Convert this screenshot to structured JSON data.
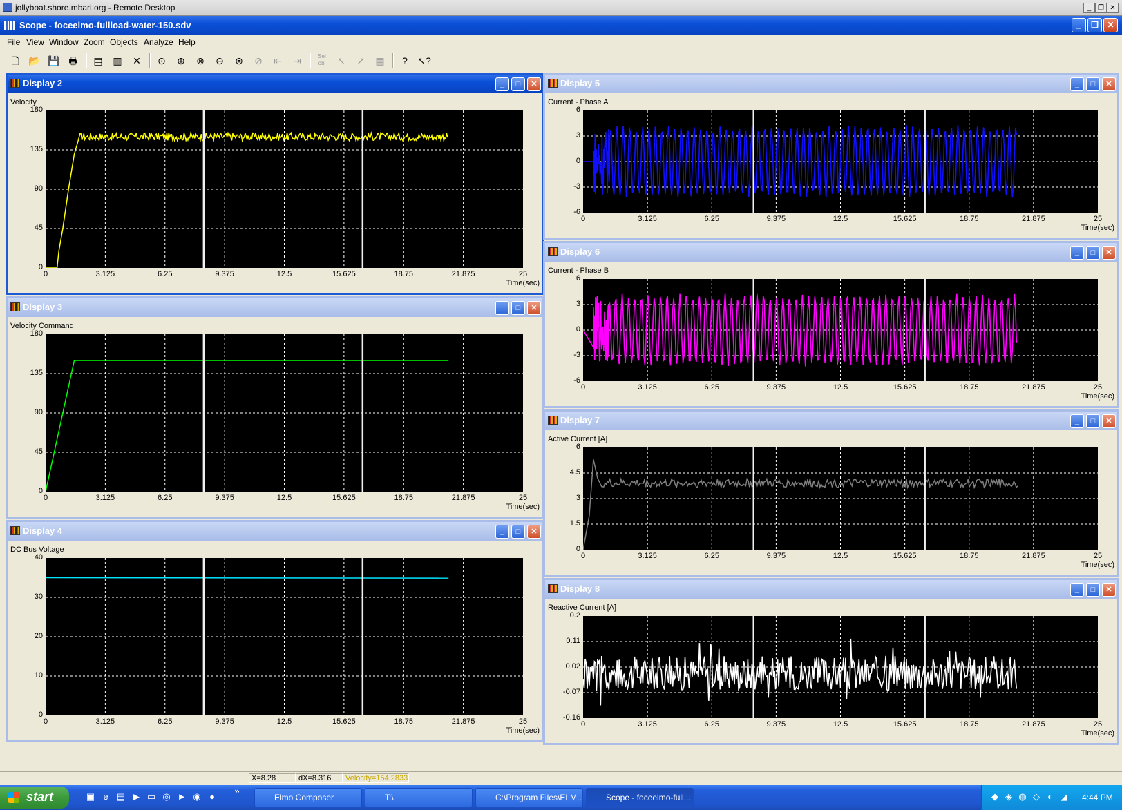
{
  "rdp": {
    "title": "jollyboat.shore.mbari.org - Remote Desktop"
  },
  "app": {
    "title": "Scope - foceelmo-fullload-water-150.sdv"
  },
  "menu": [
    "File",
    "View",
    "Window",
    "Zoom",
    "Objects",
    "Analyze",
    "Help"
  ],
  "toolbar": {
    "icons": [
      "new-file-icon",
      "open-folder-icon",
      "save-icon",
      "print-icon",
      "properties-icon",
      "chart-settings-icon",
      "delete-icon",
      "zoom-fit-icon",
      "zoom-in-icon",
      "zoom-x-icon",
      "zoom-out-icon",
      "zoom-reset-icon",
      "zoom-prev-icon",
      "scroll-left-icon",
      "scroll-right-icon",
      "select-object-icon",
      "cursor-tool-icon",
      "pointer-tool-icon",
      "export-icon",
      "help-icon",
      "context-help-icon"
    ],
    "sel_obj_label": "Sel obj"
  },
  "x_ticks": [
    "0",
    "3.125",
    "6.25",
    "9.375",
    "12.5",
    "15.625",
    "18.75",
    "21.875",
    "25"
  ],
  "x_unit": "Time(sec)",
  "colors": {
    "Display 2": "#ffff00",
    "Display 3": "#00ff00",
    "Display 4": "#00e5ff",
    "Display 5": "#1010ff",
    "Display 6": "#ff00ff",
    "Display 7": "#808080",
    "Display 8": "#ffffff"
  },
  "displays": [
    {
      "title": "Display 2",
      "label": "Velocity",
      "y_ticks": [
        "180",
        "135",
        "90",
        "45",
        "0"
      ]
    },
    {
      "title": "Display 3",
      "label": "Velocity Command",
      "y_ticks": [
        "180",
        "135",
        "90",
        "45",
        "0"
      ]
    },
    {
      "title": "Display 4",
      "label": "DC Bus Voltage",
      "y_ticks": [
        "40",
        "30",
        "20",
        "10",
        "0"
      ]
    },
    {
      "title": "Display 5",
      "label": "Current - Phase A",
      "y_ticks": [
        "6",
        "3",
        "0",
        "-3",
        "-6"
      ]
    },
    {
      "title": "Display 6",
      "label": "Current - Phase B",
      "y_ticks": [
        "6",
        "3",
        "0",
        "-3",
        "-6"
      ]
    },
    {
      "title": "Display 7",
      "label": "Active Current [A]",
      "y_ticks": [
        "6",
        "4.5",
        "3",
        "1.5",
        "0"
      ]
    },
    {
      "title": "Display 8",
      "label": "Reactive Current [A]",
      "y_ticks": [
        "0.2",
        "0.11",
        "0.02",
        "-0.07",
        "-0.16"
      ]
    }
  ],
  "chart_data": [
    {
      "type": "line",
      "title": "Display 2",
      "ylabel": "Velocity",
      "xlabel": "Time(sec)",
      "xlim": [
        0,
        25
      ],
      "ylim": [
        0,
        180
      ],
      "grid": true,
      "series": [
        {
          "values": [
            [
              0,
              0
            ],
            [
              0.6,
              0
            ],
            [
              0.9,
              45
            ],
            [
              1.2,
              90
            ],
            [
              1.6,
              135
            ],
            [
              1.9,
              148
            ],
            [
              3,
              150
            ],
            [
              6,
              149
            ],
            [
              9,
              150
            ],
            [
              12,
              148
            ],
            [
              15,
              150
            ],
            [
              18,
              149
            ],
            [
              21,
              150
            ],
            [
              21.1,
              148
            ]
          ]
        }
      ],
      "cursors": [
        8.28,
        16.6
      ]
    },
    {
      "type": "line",
      "title": "Display 3",
      "ylabel": "Velocity Command",
      "xlabel": "Time(sec)",
      "xlim": [
        0,
        25
      ],
      "ylim": [
        0,
        180
      ],
      "grid": true,
      "series": [
        {
          "values": [
            [
              0,
              0
            ],
            [
              0.5,
              30
            ],
            [
              1,
              80
            ],
            [
              1.5,
              150
            ],
            [
              21.1,
              150
            ]
          ]
        }
      ],
      "cursors": [
        8.28,
        16.6
      ]
    },
    {
      "type": "line",
      "title": "Display 4",
      "ylabel": "DC Bus Voltage",
      "xlabel": "Time(sec)",
      "xlim": [
        0,
        25
      ],
      "ylim": [
        0,
        40
      ],
      "grid": true,
      "series": [
        {
          "values": [
            [
              0,
              35
            ],
            [
              5,
              34.9
            ],
            [
              10,
              34.9
            ],
            [
              15,
              34.9
            ],
            [
              21.1,
              34.9
            ]
          ]
        }
      ],
      "cursors": [
        8.28,
        16.6
      ]
    },
    {
      "type": "line",
      "title": "Display 5",
      "ylabel": "Current - Phase A",
      "xlabel": "Time(sec)",
      "xlim": [
        0,
        25
      ],
      "ylim": [
        -6,
        6
      ],
      "grid": true,
      "series": [
        {
          "values": [
            [
              0,
              0
            ],
            [
              0.5,
              0
            ],
            [
              1,
              4
            ],
            [
              21,
              4
            ],
            [
              21,
              -4
            ]
          ]
        }
      ],
      "cursors": [
        8.28,
        16.6
      ]
    },
    {
      "type": "line",
      "title": "Display 6",
      "ylabel": "Current - Phase B",
      "xlabel": "Time(sec)",
      "xlim": [
        0,
        25
      ],
      "ylim": [
        -6,
        6
      ],
      "grid": true,
      "series": [
        {
          "values": [
            [
              0,
              -1
            ],
            [
              0.5,
              -3
            ],
            [
              1,
              4
            ],
            [
              21,
              4
            ],
            [
              21,
              -4
            ]
          ]
        }
      ],
      "cursors": [
        8.28,
        16.6
      ]
    },
    {
      "type": "line",
      "title": "Display 7",
      "ylabel": "Active Current [A]",
      "xlabel": "Time(sec)",
      "xlim": [
        0,
        25
      ],
      "ylim": [
        0,
        6
      ],
      "grid": true,
      "series": [
        {
          "values": [
            [
              0,
              0
            ],
            [
              0.3,
              2
            ],
            [
              0.5,
              5.3
            ],
            [
              0.8,
              3.8
            ],
            [
              3,
              3.9
            ],
            [
              10,
              3.7
            ],
            [
              15,
              4
            ],
            [
              21,
              4
            ]
          ]
        }
      ],
      "cursors": [
        8.28,
        16.6
      ]
    },
    {
      "type": "line",
      "title": "Display 8",
      "ylabel": "Reactive Current [A]",
      "xlabel": "Time(sec)",
      "xlim": [
        0,
        25
      ],
      "ylim": [
        -0.16,
        0.2
      ],
      "grid": true,
      "series": [
        {
          "values": [
            [
              0,
              0
            ],
            [
              5,
              0.02
            ],
            [
              10,
              -0.02
            ],
            [
              15,
              0.03
            ],
            [
              21,
              0
            ]
          ]
        }
      ],
      "cursors": [
        8.28,
        16.6
      ]
    }
  ],
  "status": {
    "x": "X=8.28",
    "dx": "dX=8.316",
    "velocity": "Velocity=154.2833"
  },
  "taskbar": {
    "start": "start",
    "tasks": [
      "Elmo Composer",
      "T:\\",
      "C:\\Program Files\\ELM...",
      "Scope - foceelmo-full..."
    ],
    "clock": "4:44 PM",
    "overflow": "»"
  }
}
